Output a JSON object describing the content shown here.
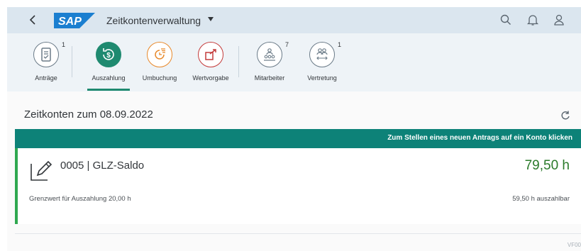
{
  "shell": {
    "logo_text": "SAP",
    "app_title": "Zeitkontenverwaltung",
    "icons": [
      "back-icon",
      "chevron-down-icon",
      "search-icon",
      "bell-icon",
      "user-icon"
    ]
  },
  "tabs": [
    {
      "label": "Anträge",
      "count": "1",
      "icon": "document-check-icon",
      "color": "#6b7b88",
      "active": false
    },
    {
      "label": "Auszahlung",
      "count": "",
      "icon": "money-clock-icon",
      "color": "#1f8a70",
      "active": true
    },
    {
      "label": "Umbuchung",
      "count": "",
      "icon": "time-list-icon",
      "color": "#e8892b",
      "active": false
    },
    {
      "label": "Wertvorgabe",
      "count": "",
      "icon": "box-arrow-icon",
      "color": "#c43b3b",
      "active": false
    },
    {
      "label": "Mitarbeiter",
      "count": "7",
      "icon": "employees-icon",
      "color": "#6b7b88",
      "active": false
    },
    {
      "label": "Vertretung",
      "count": "1",
      "icon": "substitute-icon",
      "color": "#6b7b88",
      "active": false
    }
  ],
  "main": {
    "heading": "Zeitkonten zum 08.09.2022",
    "hint_bar": "Zum Stellen eines neuen Antrags auf ein Konto klicken",
    "account": {
      "title": "0005 | GLZ-Saldo",
      "balance": "79,50 h",
      "threshold": "Grenzwert für Auszahlung 20,00 h",
      "payable": "59,50 h auszahlbar"
    },
    "footer_code": "VF00"
  },
  "colors": {
    "shell_bg": "#dbe6ef",
    "accent": "#0d8278",
    "positive": "#2a7a2a",
    "card_marker": "#2fa84f"
  }
}
